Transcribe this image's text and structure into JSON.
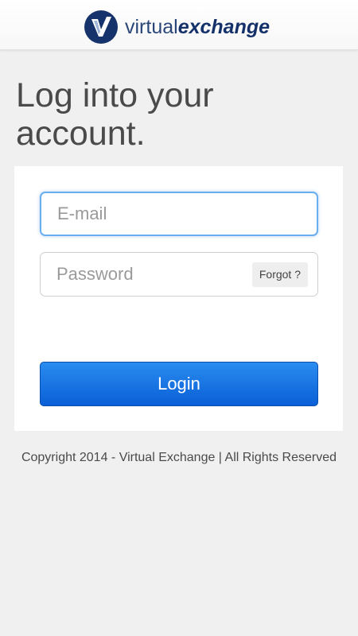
{
  "header": {
    "logo_text_light": "virtual",
    "logo_text_bold": "exchange"
  },
  "page": {
    "title": "Log into your account."
  },
  "login_form": {
    "email_placeholder": "E-mail",
    "email_value": "",
    "password_placeholder": "Password",
    "password_value": "",
    "forgot_label": "Forgot ?",
    "login_label": "Login"
  },
  "footer": {
    "copyright": "Copyright 2014 - Virtual Exchange | All Rights Reserved"
  },
  "colors": {
    "brand_navy": "#1a3a6e",
    "primary_button": "#0a6ae0",
    "focus_ring": "#6aaef0",
    "background": "#f0f0f0"
  },
  "icons": {
    "logo": "virtual-exchange-v-logo-icon"
  }
}
